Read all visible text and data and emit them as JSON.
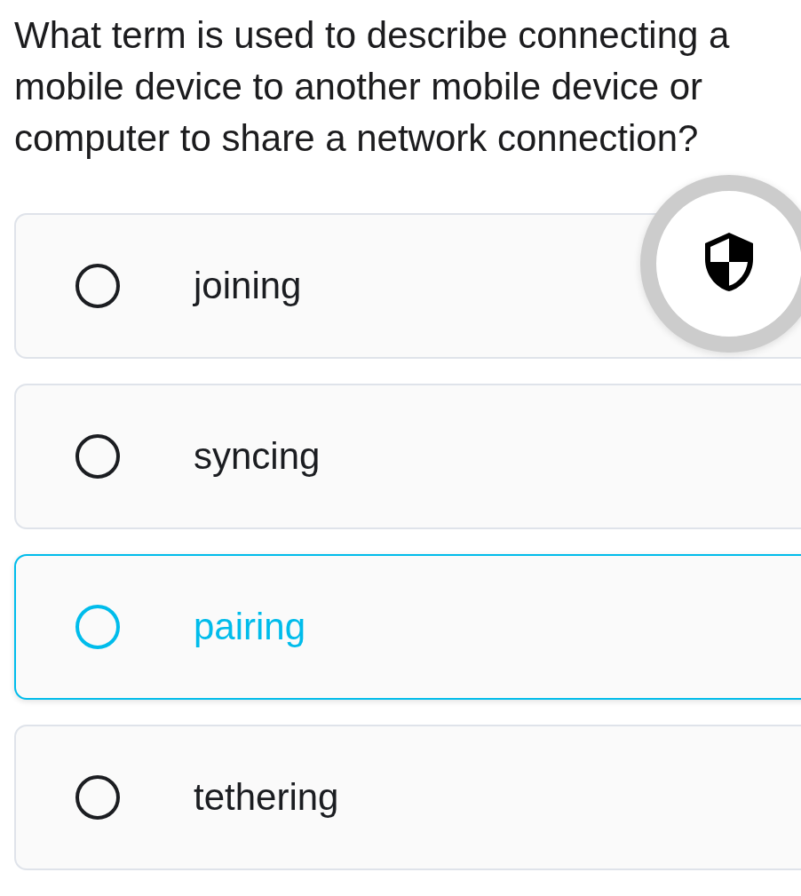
{
  "question": "What term is used to describe connecting a mobile device to another mobile device or computer to share a network connection?",
  "options": [
    {
      "label": "joining",
      "selected": false
    },
    {
      "label": "syncing",
      "selected": false
    },
    {
      "label": "pairing",
      "selected": true
    },
    {
      "label": "tethering",
      "selected": false
    }
  ]
}
